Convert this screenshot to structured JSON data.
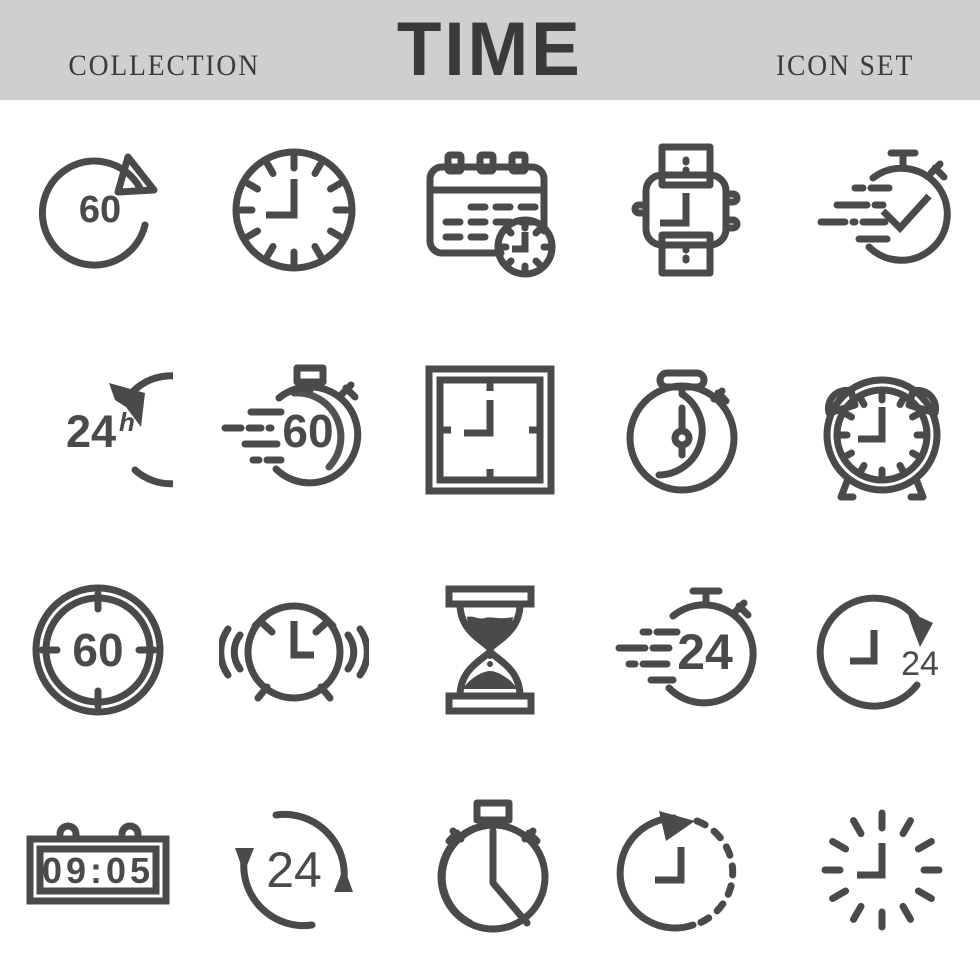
{
  "header": {
    "left_text": "COLLECTION",
    "title": "TIME",
    "right_text": "ICON SET",
    "background_color": "#cfcfcf",
    "text_color": "#3a3a3a"
  },
  "style": {
    "ink_color": "#4a4a4a",
    "page_background": "#ffffff",
    "stroke_width": 7
  },
  "grid": {
    "columns": 5,
    "rows": 4,
    "count": 20
  },
  "icons": [
    {
      "id": "refresh-60",
      "name": "circular-arrow-60-icon",
      "label": "60",
      "row": 1,
      "col": 1
    },
    {
      "id": "wall-clock",
      "name": "analog-clock-icon",
      "label": "",
      "row": 1,
      "col": 2
    },
    {
      "id": "calendar-clock",
      "name": "calendar-clock-icon",
      "label": "",
      "row": 1,
      "col": 3
    },
    {
      "id": "wrist-watch",
      "name": "wristwatch-icon",
      "label": "",
      "row": 1,
      "col": 4
    },
    {
      "id": "fast-stopwatch-check",
      "name": "fast-stopwatch-check-icon",
      "label": "",
      "row": 1,
      "col": 5
    },
    {
      "id": "solid-24h",
      "name": "solid-circular-arrow-24h-icon",
      "label": "24",
      "superscript": "h",
      "row": 2,
      "col": 1
    },
    {
      "id": "fast-stopwatch-60",
      "name": "fast-stopwatch-60-icon",
      "label": "60",
      "row": 2,
      "col": 2
    },
    {
      "id": "square-clock",
      "name": "square-clock-icon",
      "label": "",
      "row": 2,
      "col": 3
    },
    {
      "id": "stopwatch-needle",
      "name": "stopwatch-needle-icon",
      "label": "",
      "row": 2,
      "col": 4
    },
    {
      "id": "alarm-clock",
      "name": "alarm-clock-icon",
      "label": "",
      "row": 2,
      "col": 5
    },
    {
      "id": "ring-60",
      "name": "double-ring-timer-60-icon",
      "label": "60",
      "row": 3,
      "col": 1
    },
    {
      "id": "ringing-alarm",
      "name": "ringing-alarm-clock-icon",
      "label": "",
      "row": 3,
      "col": 2
    },
    {
      "id": "hourglass",
      "name": "hourglass-icon",
      "label": "",
      "row": 3,
      "col": 3
    },
    {
      "id": "fast-stopwatch-24",
      "name": "fast-stopwatch-24-icon",
      "label": "24",
      "row": 3,
      "col": 4
    },
    {
      "id": "arrow-clock-24",
      "name": "circular-arrow-clock-24-icon",
      "label": "24",
      "row": 3,
      "col": 5
    },
    {
      "id": "digital-clock",
      "name": "digital-clock-icon",
      "label": "09:05",
      "row": 4,
      "col": 1
    },
    {
      "id": "cycle-24",
      "name": "two-arrow-cycle-24-icon",
      "label": "24",
      "row": 4,
      "col": 2
    },
    {
      "id": "stopwatch-sector",
      "name": "stopwatch-elapsed-sector-icon",
      "label": "",
      "row": 4,
      "col": 3
    },
    {
      "id": "dashed-arrow-clock",
      "name": "dashed-circle-arrow-clock-icon",
      "label": "",
      "row": 4,
      "col": 4
    },
    {
      "id": "tick-clock",
      "name": "tick-marks-clock-icon",
      "label": "",
      "row": 4,
      "col": 5
    }
  ],
  "digital_clock": {
    "hours": "09",
    "separator": ":",
    "minutes": "05"
  }
}
